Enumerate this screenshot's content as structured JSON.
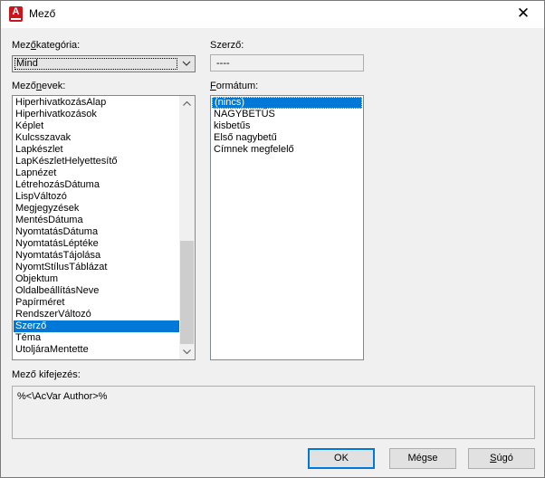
{
  "window": {
    "title": "Mező",
    "close_glyph": "✕",
    "app_icon_letter": "A",
    "accent_color": "#c8161d"
  },
  "category": {
    "label_prefix": "Mez",
    "label_underlined": "ő",
    "label_suffix": "kategória:",
    "selected": "Mind"
  },
  "author": {
    "label": "Szerző:",
    "value": "----"
  },
  "field_names": {
    "label_prefix": "Mező",
    "label_underlined": "n",
    "label_suffix": "evek:",
    "items": [
      "HiperhivatkozásAlap",
      "Hiperhivatkozások",
      "Képlet",
      "Kulcsszavak",
      "Lapkészlet",
      "LapKészletHelyettesítő",
      "Lapnézet",
      "LétrehozásDátuma",
      "LispVáltozó",
      "Megjegyzések",
      "MentésDátuma",
      "NyomtatásDátuma",
      "NyomtatásLéptéke",
      "NyomtatásTájolása",
      "NyomtStílusTáblázat",
      "Objektum",
      "OldalbeállításNeve",
      "Papírméret",
      "RendszerVáltozó",
      "Szerző",
      "Téma",
      "UtoljáraMentette"
    ],
    "selected_index": 19
  },
  "format": {
    "label_prefix": "",
    "label_underlined": "F",
    "label_suffix": "ormátum:",
    "items": [
      "(nincs)",
      "NAGYBETŰS",
      "kisbetűs",
      "Első nagybetű",
      "Címnek megfelelő"
    ],
    "selected_index": 0
  },
  "expression": {
    "label": "Mező kifejezés:",
    "value": "%<\\AcVar Author>%"
  },
  "buttons": {
    "ok": "OK",
    "cancel": "Mégse",
    "help_underlined": "S",
    "help_rest": "úgó"
  }
}
